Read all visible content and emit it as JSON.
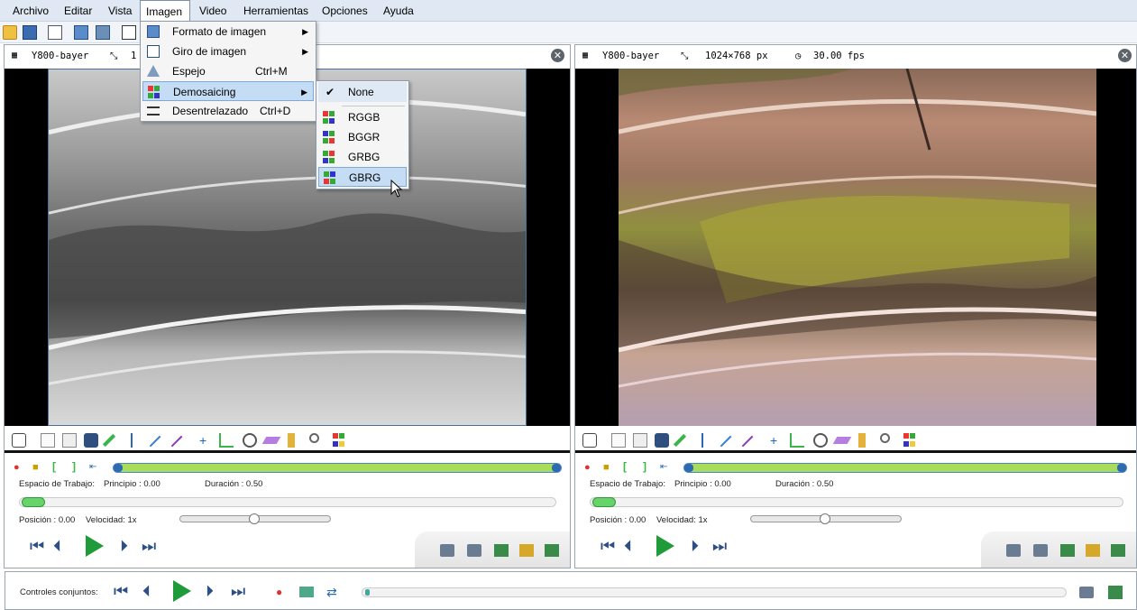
{
  "menubar": {
    "items": [
      "Archivo",
      "Editar",
      "Vista",
      "Imagen",
      "Video",
      "Herramientas",
      "Opciones",
      "Ayuda"
    ]
  },
  "imagen_menu": {
    "items": [
      {
        "label": "Formato de imagen",
        "shortcut": "",
        "submenu": true
      },
      {
        "label": "Giro de imagen",
        "shortcut": "",
        "submenu": true
      },
      {
        "label": "Espejo",
        "shortcut": "Ctrl+M",
        "submenu": false
      },
      {
        "label": "Demosaicing",
        "shortcut": "",
        "submenu": true
      },
      {
        "label": "Desentrelazado",
        "shortcut": "Ctrl+D",
        "submenu": false
      }
    ]
  },
  "demosaicing_menu": {
    "items": [
      "None",
      "RGGB",
      "BGGR",
      "GRBG",
      "GBRG"
    ],
    "checked": "None",
    "highlighted": "GBRG"
  },
  "left_pane": {
    "format": "Y800-bayer",
    "resolution_partial": "1"
  },
  "right_pane": {
    "format": "Y800-bayer",
    "resolution": "1024×768 px",
    "fps": "30.00 fps"
  },
  "controls": {
    "workspace_label": "Espacio de Trabajo:",
    "start_label": "Principio : 0.00",
    "duration_label": "Duración : 0.50",
    "position_label": "Posición : 0.00",
    "speed_label": "Velocidad: 1x",
    "speed_slider_fraction": 0.5,
    "position_fraction": 0.0
  },
  "joint": {
    "label": "Controles conjuntos:"
  },
  "icons": {
    "close": "close-icon",
    "capture": "camera-icon",
    "record": "record-icon",
    "play": "play-icon",
    "marker": "marker-icon"
  },
  "colors": {
    "accent_green": "#1f9b3a",
    "track_green": "#a8dd5c",
    "menu_highlight": "#c4ddf5"
  }
}
